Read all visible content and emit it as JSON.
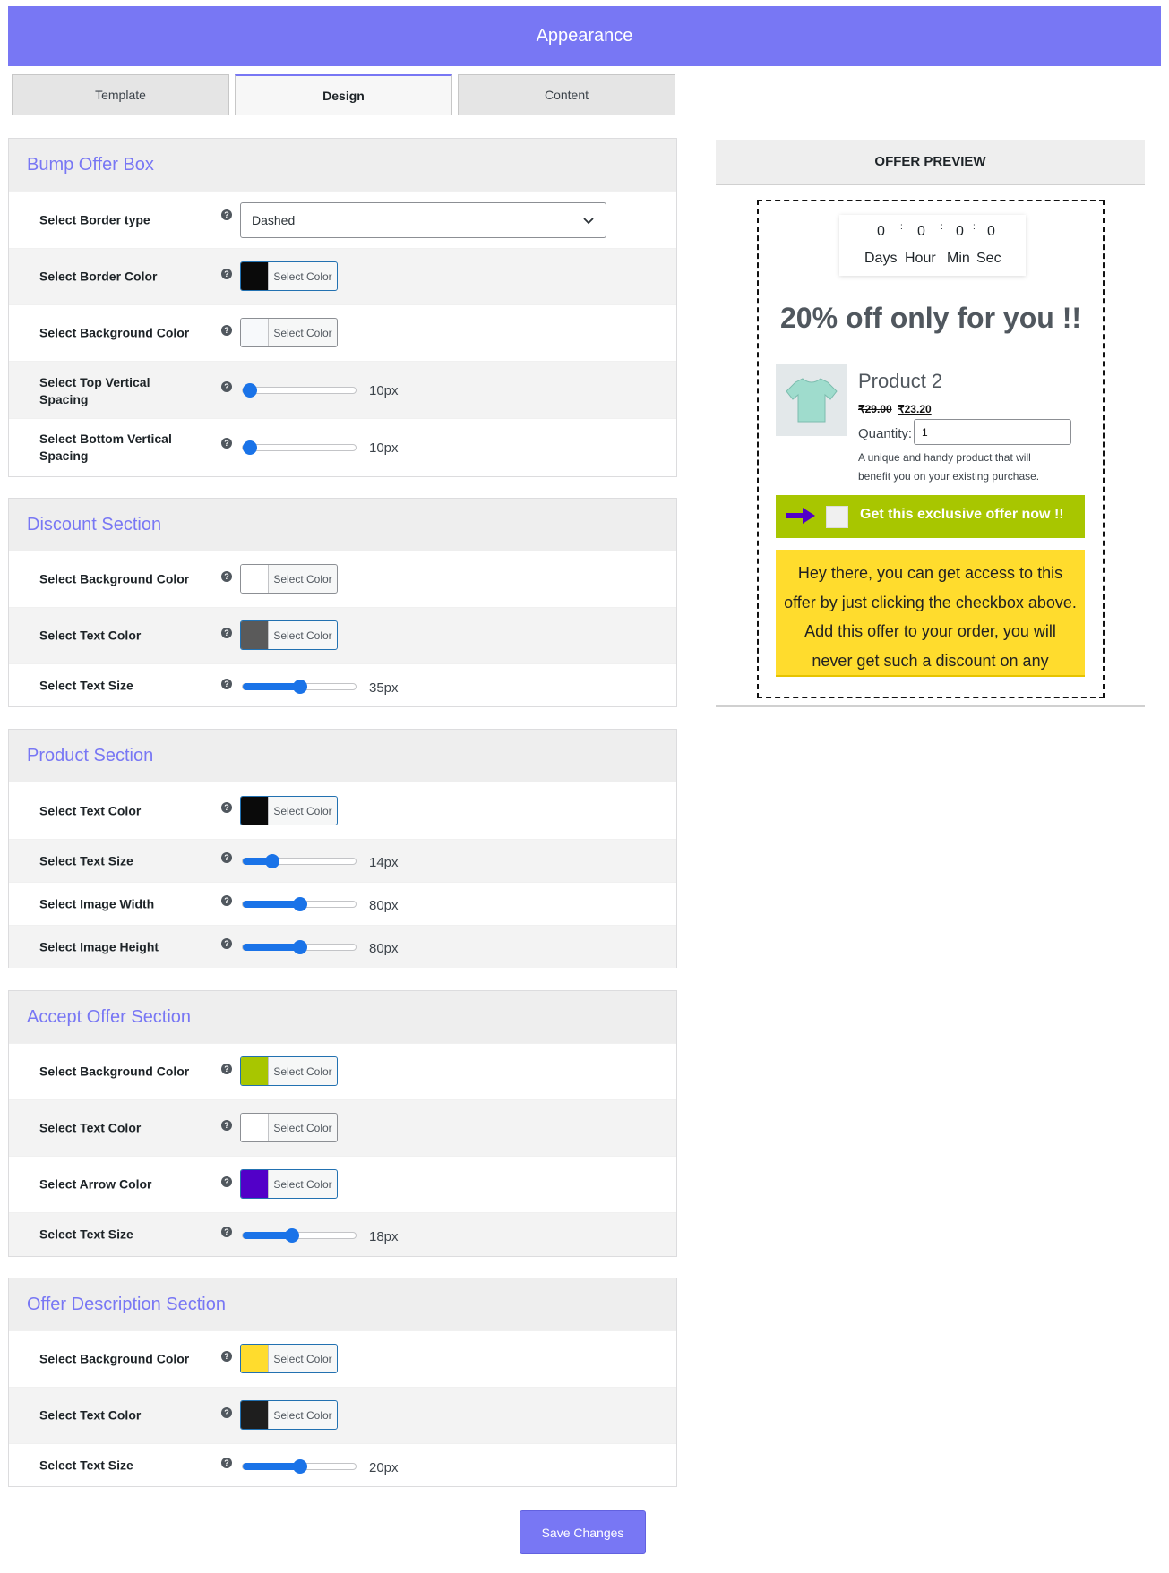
{
  "header": {
    "title": "Appearance"
  },
  "tabs": [
    "Template",
    "Design",
    "Content"
  ],
  "help_glyph": "?",
  "color_button_label": "Select Color",
  "sections": {
    "bump_offer_box": {
      "title": "Bump Offer Box",
      "border_type": {
        "label": "Select Border type",
        "value": "Dashed"
      },
      "border_color": {
        "label": "Select Border Color",
        "color": "#0a0a0a"
      },
      "background_color": {
        "label": "Select Background Color",
        "color": "#f7f9fb"
      },
      "top_spacing": {
        "label": "Select Top Vertical Spacing",
        "value": "10px",
        "fraction": 0.0
      },
      "bottom_spacing": {
        "label": "Select Bottom Vertical Spacing",
        "value": "10px",
        "fraction": 0.0
      }
    },
    "discount_section": {
      "title": "Discount Section",
      "background_color": {
        "label": "Select Background Color",
        "color": "#ffffff"
      },
      "text_color": {
        "label": "Select Text Color",
        "color": "#5a5a5a"
      },
      "text_size": {
        "label": "Select Text Size",
        "value": "35px",
        "fraction": 0.5
      }
    },
    "product_section": {
      "title": "Product Section",
      "text_color": {
        "label": "Select Text Color",
        "color": "#0a0a0a"
      },
      "text_size": {
        "label": "Select Text Size",
        "value": "14px",
        "fraction": 0.22
      },
      "image_width": {
        "label": "Select Image Width",
        "value": "80px",
        "fraction": 0.5
      },
      "image_height": {
        "label": "Select Image Height",
        "value": "80px",
        "fraction": 0.5
      }
    },
    "accept_offer_section": {
      "title": "Accept Offer Section",
      "background_color": {
        "label": "Select Background Color",
        "color": "#a8c600"
      },
      "text_color": {
        "label": "Select Text Color",
        "color": "#ffffff"
      },
      "arrow_color": {
        "label": "Select Arrow Color",
        "color": "#5200c8"
      },
      "text_size": {
        "label": "Select Text Size",
        "value": "18px",
        "fraction": 0.42
      }
    },
    "offer_description_section": {
      "title": "Offer Description Section",
      "background_color": {
        "label": "Select Background Color",
        "color": "#ffdc2d"
      },
      "text_color": {
        "label": "Select Text Color",
        "color": "#1e1e1e"
      },
      "text_size": {
        "label": "Select Text Size",
        "value": "20px",
        "fraction": 0.5
      }
    }
  },
  "preview": {
    "heading": "OFFER PREVIEW",
    "timer": {
      "values": [
        "0",
        "0",
        "0",
        "0"
      ],
      "separator": ":",
      "labels": [
        "Days",
        "Hour",
        "Min",
        "Sec"
      ]
    },
    "discount_text": "20% off only for you !!",
    "product_name": "Product 2",
    "price_old": "₹29.00",
    "price_new": "₹23.20",
    "quantity_label": "Quantity:",
    "quantity_value": "1",
    "product_description": "A unique and handy product that will benefit you on your existing purchase.",
    "accept_text": "Get this exclusive offer now !!",
    "description_text": "Hey there, you can get access to this offer by just clicking the checkbox above. Add this offer to your order, you will never get such a discount on any"
  },
  "save_button": "Save Changes"
}
